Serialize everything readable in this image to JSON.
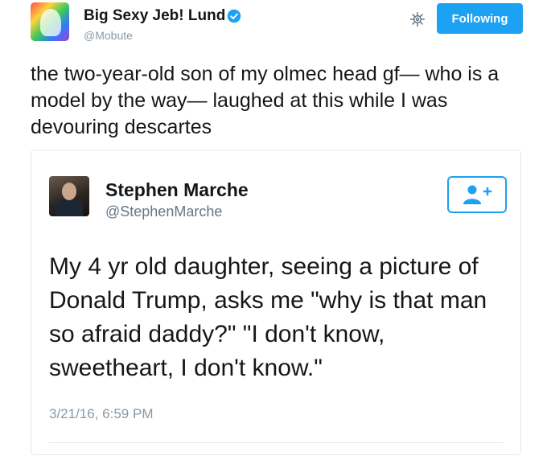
{
  "author": {
    "display_name": "Big Sexy Jeb! Lund",
    "handle": "@Mobute",
    "verified": true
  },
  "actions": {
    "follow_label": "Following",
    "settings_icon": "gear-icon"
  },
  "tweet": {
    "text": "the two-year-old son of my olmec head gf— who is a model by the way— laughed at this while I was devouring descartes"
  },
  "quoted_tweet": {
    "display_name": "Stephen Marche",
    "handle": "@StephenMarche",
    "follow_icon": "add-user-icon",
    "text": "My 4 yr old daughter, seeing a picture of Donald Trump, asks me \"why is that man so afraid daddy?\" \"I don't know, sweetheart, I don't know.\"",
    "timestamp": "3/21/16, 6:59 PM"
  },
  "colors": {
    "accent": "#1da1f2",
    "text": "#14171a",
    "muted": "#8899a6",
    "border": "#e1e8ed"
  }
}
